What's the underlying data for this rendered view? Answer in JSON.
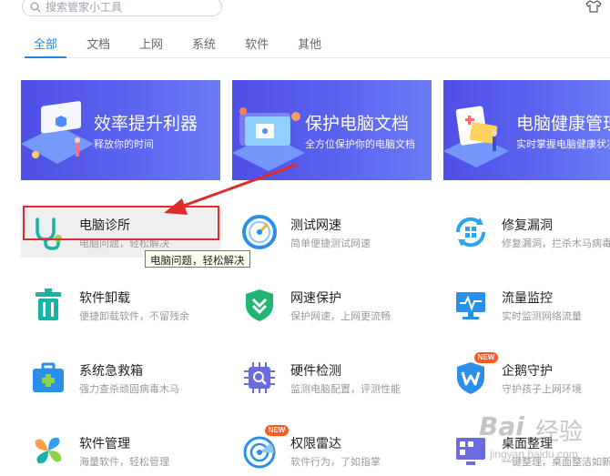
{
  "search": {
    "placeholder": "搜索管家小工具"
  },
  "tabs": [
    {
      "label": "全部"
    },
    {
      "label": "文档"
    },
    {
      "label": "上网"
    },
    {
      "label": "系统"
    },
    {
      "label": "软件"
    },
    {
      "label": "其他"
    }
  ],
  "banners": [
    {
      "title": "效率提升利器",
      "subtitle": "释放你的时间"
    },
    {
      "title": "保护电脑文档",
      "subtitle": "全方位保护你的电脑文档"
    },
    {
      "title": "电脑健康管理",
      "subtitle": "实时掌握电脑健康状况"
    }
  ],
  "tools": [
    {
      "name": "电脑诊所",
      "desc": "电脑问题，轻松解决",
      "icon": "stethoscope-icon"
    },
    {
      "name": "测试网速",
      "desc": "简单便捷测试网速",
      "icon": "speedometer-icon"
    },
    {
      "name": "修复漏洞",
      "desc": "修复漏洞，拦杀木马病毒",
      "icon": "windows-repair-icon"
    },
    {
      "name": "软件卸载",
      "desc": "便捷卸载软件，不留残余",
      "icon": "trash-icon"
    },
    {
      "name": "网速保护",
      "desc": "保护网速，上网更流畅",
      "icon": "shield-chevron-icon"
    },
    {
      "name": "流量监控",
      "desc": "实时监测网络流量",
      "icon": "monitor-pulse-icon"
    },
    {
      "name": "系统急救箱",
      "desc": "强力查杀顽固病毒木马",
      "icon": "first-aid-kit-icon"
    },
    {
      "name": "硬件检测",
      "desc": "监测电脑配置，评测性能",
      "icon": "chip-search-icon"
    },
    {
      "name": "企鹅守护",
      "desc": "守护孩子上网环境",
      "icon": "penguin-shield-icon",
      "badge": "NEW"
    },
    {
      "name": "软件管理",
      "desc": "海量软件，轻松管理",
      "icon": "clover-icon"
    },
    {
      "name": "权限雷达",
      "desc": "软件行为，了如指掌",
      "icon": "radar-icon",
      "badge": "NEW"
    },
    {
      "name": "桌面整理",
      "desc": "一键整理，桌面整洁如新",
      "icon": "desktop-grid-icon"
    }
  ],
  "tooltip": "电脑问题，轻松解决",
  "watermark": {
    "logo": "Bai",
    "text": "经验",
    "url": "jingyan.baidu.com"
  },
  "colors": {
    "accent": "#2a82e4",
    "highlight_box": "#e02b2b",
    "new_badge": "#ff5a1f"
  }
}
